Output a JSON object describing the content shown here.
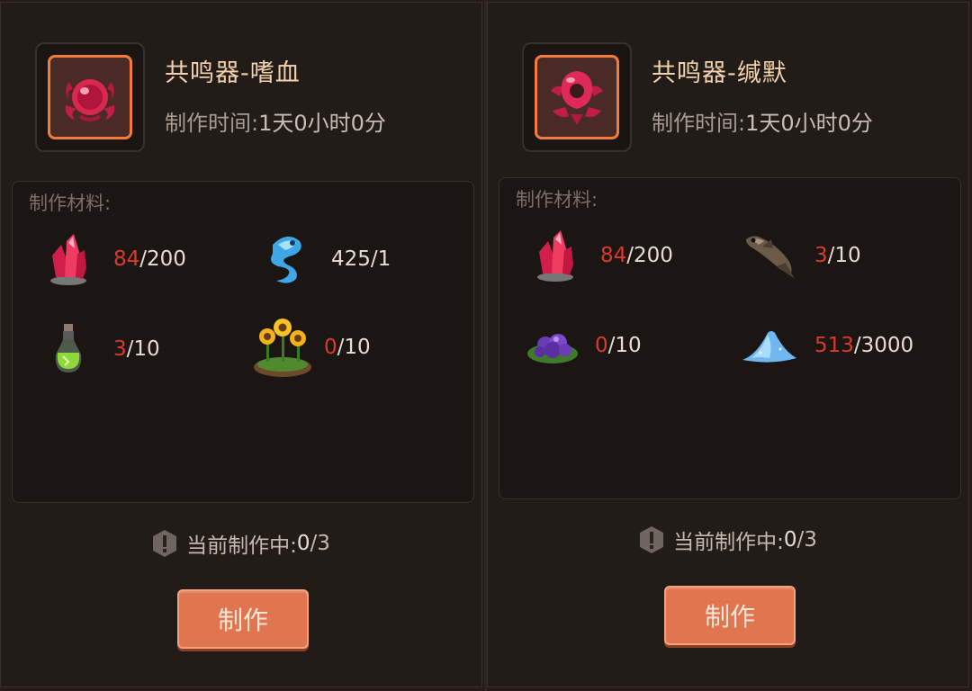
{
  "recipes": [
    {
      "icon": "bloodthirst-resonator-icon",
      "title": "共鸣器-嗜血",
      "time_label": "制作时间:",
      "time_value": "1天0小时0分",
      "materials_label": "制作材料:",
      "materials": [
        {
          "icon": "red-crystal-icon",
          "have": "84",
          "need": "/200",
          "sufficient": false
        },
        {
          "icon": "blue-spirit-icon",
          "have": "425",
          "need": "/1",
          "sufficient": true
        },
        {
          "icon": "green-potion-icon",
          "have": "3",
          "need": "/10",
          "sufficient": false
        },
        {
          "icon": "sunflower-patch-icon",
          "have": "0",
          "need": "/10",
          "sufficient": false
        }
      ],
      "status_label": "当前制作中:",
      "status_current": "0",
      "status_total": "/3",
      "button_label": "制作"
    },
    {
      "icon": "silence-resonator-icon",
      "title": "共鸣器-缄默",
      "time_label": "制作时间:",
      "time_value": "1天0小时0分",
      "materials_label": "制作材料:",
      "materials": [
        {
          "icon": "red-crystal-icon",
          "have": "84",
          "need": "/200",
          "sufficient": false
        },
        {
          "icon": "fish-icon",
          "have": "3",
          "need": "/10",
          "sufficient": false
        },
        {
          "icon": "purple-flower-icon",
          "have": "0",
          "need": "/10",
          "sufficient": false
        },
        {
          "icon": "blue-sand-pile-icon",
          "have": "513",
          "need": "/3000",
          "sufficient": false
        }
      ],
      "status_label": "当前制作中:",
      "status_current": "0",
      "status_total": "/3",
      "button_label": "制作"
    }
  ],
  "colors": {
    "accent": "#f27d3a",
    "button": "#e07550",
    "insufficient": "#d93a2b",
    "title": "#f2d2ac"
  }
}
